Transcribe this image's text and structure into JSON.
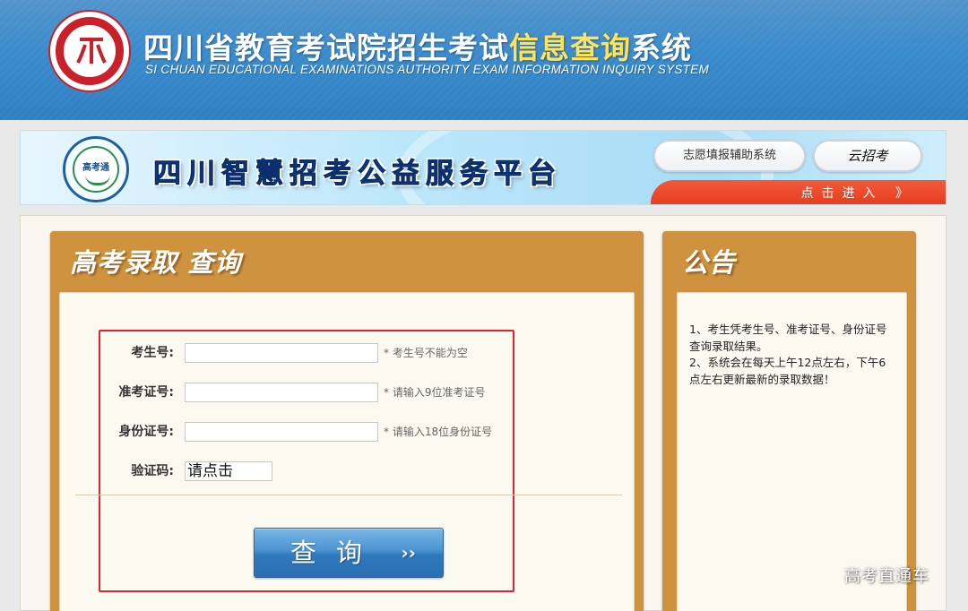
{
  "header": {
    "title_part1": "四川省教育考试院招生考试",
    "title_highlight": "信息查询",
    "title_part2": "系统",
    "subtitle": "SI CHUAN EDUCATIONAL EXAMINATIONS AUTHORITY EXAM INFORMATION INQUIRY SYSTEM"
  },
  "banner": {
    "logo_text": "高考通",
    "title": "四川智慧招考公益服务平台",
    "link1": "志愿填报辅助系统",
    "link2": "云招考",
    "enter_text": "点击进入 》"
  },
  "query_panel": {
    "title": "高考录取 查询",
    "fields": [
      {
        "label": "考生号:",
        "value": "",
        "placeholder": "",
        "hint": "* 考生号不能为空"
      },
      {
        "label": "准考证号:",
        "value": "",
        "placeholder": "",
        "hint": "* 请输入9位准考证号"
      },
      {
        "label": "身份证号:",
        "value": "",
        "placeholder": "",
        "hint": "* 请输入18位身份证号"
      }
    ],
    "captcha_label": "验证码:",
    "captcha_text": "请点击",
    "submit_label": "查询",
    "submit_arrows": "››"
  },
  "notice_panel": {
    "title": "公告",
    "lines": [
      "1、考生凭考生号、准考证号、身份证号查询录取结果。",
      "2、系统会在每天上午12点左右，下午6点左右更新最新的录取数据！"
    ]
  },
  "watermark": "高考直通车",
  "colors": {
    "header_blue": "#2d7dc0",
    "panel_orange": "#cf933f",
    "highlight_red": "#e3222f",
    "button_blue": "#2f79bc",
    "enter_red": "#e63a1d"
  },
  "icons": {
    "seal": "education-authority-seal-icon",
    "platform_logo": "gaokaotong-logo-icon",
    "submit": "double-chevron-right-icon"
  }
}
